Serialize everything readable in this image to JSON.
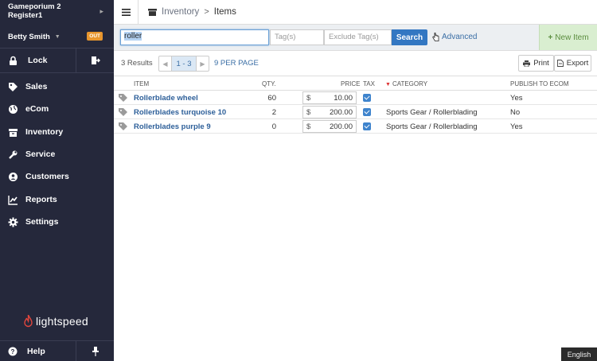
{
  "sidebar": {
    "store_name": "Gameporium 2",
    "register": "Register1",
    "user": "Betty Smith",
    "out_badge": "OUT",
    "lock_label": "Lock",
    "items": [
      {
        "label": "Sales",
        "icon": "tag-icon"
      },
      {
        "label": "eCom",
        "icon": "globe-icon"
      },
      {
        "label": "Inventory",
        "icon": "box-icon"
      },
      {
        "label": "Service",
        "icon": "wrench-icon"
      },
      {
        "label": "Customers",
        "icon": "user-icon"
      },
      {
        "label": "Reports",
        "icon": "chart-icon"
      },
      {
        "label": "Settings",
        "icon": "gear-icon"
      }
    ],
    "logo_text": "lightspeed",
    "help_label": "Help"
  },
  "breadcrumb": {
    "parent": "Inventory",
    "separator": ">",
    "current": "Items"
  },
  "search": {
    "query": "roller",
    "tags_placeholder": "Tag(s)",
    "exclude_placeholder": "Exclude Tag(s)",
    "search_label": "Search",
    "advanced_label": "Advanced",
    "new_item_label": "New Item"
  },
  "toolbar": {
    "results": "3 Results",
    "page_range": "1 - 3",
    "per_page": "9 PER PAGE",
    "print_label": "Print",
    "export_label": "Export"
  },
  "table": {
    "headers": {
      "item": "ITEM",
      "qty": "QTY.",
      "price": "PRICE",
      "tax": "TAX",
      "category": "CATEGORY",
      "publish": "PUBLISH TO ECOM"
    },
    "rows": [
      {
        "item": "Rollerblade wheel",
        "qty": "60",
        "currency": "$",
        "price": "10.00",
        "category": "",
        "publish": "Yes"
      },
      {
        "item": "Rollerblades turquoise 10",
        "qty": "2",
        "currency": "$",
        "price": "200.00",
        "category": "Sports Gear / Rollerblading",
        "publish": "No"
      },
      {
        "item": "Rollerblades purple 9",
        "qty": "0",
        "currency": "$",
        "price": "200.00",
        "category": "Sports Gear / Rollerblading",
        "publish": "Yes"
      }
    ]
  },
  "language": "English",
  "colors": {
    "sidebar_bg": "#25283b",
    "accent": "#3377c2",
    "new_item_bg": "#d9eed0",
    "out_badge": "#e8962e",
    "logo_red": "#e2463d"
  }
}
